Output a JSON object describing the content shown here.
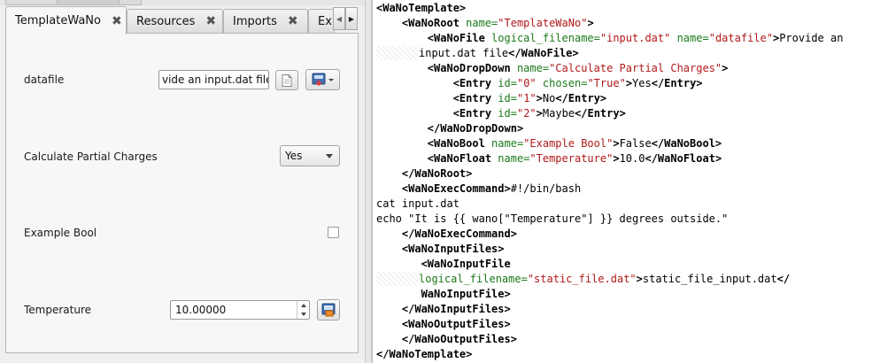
{
  "tabs": [
    {
      "label": "TemplateWaNo",
      "close": "✖"
    },
    {
      "label": "Resources",
      "close": "✖"
    },
    {
      "label": "Imports",
      "close": "✖"
    },
    {
      "label": "Ex"
    }
  ],
  "form": {
    "datafile": {
      "label": "datafile",
      "value": "vide an input.dat file"
    },
    "partial_charges": {
      "label": "Calculate Partial Charges",
      "selected": "Yes"
    },
    "example_bool": {
      "label": "Example Bool",
      "checked": false
    },
    "temperature": {
      "label": "Temperature",
      "value": "10.00000"
    }
  },
  "code": [
    [
      {
        "c": "t",
        "s": "<WaNoTemplate>"
      }
    ],
    [
      {
        "c": "t",
        "s": "    <WaNoRoot "
      },
      {
        "c": "a",
        "s": "name="
      },
      {
        "c": "v",
        "s": "\"TemplateWaNo\""
      },
      {
        "c": "t",
        "s": ">"
      }
    ],
    [
      {
        "c": "t",
        "s": "        <WaNoFile "
      },
      {
        "c": "a",
        "s": "logical_filename="
      },
      {
        "c": "v",
        "s": "\"input.dat\""
      },
      {
        "c": "a",
        "s": " name="
      },
      {
        "c": "v",
        "s": "\"datafile\""
      },
      {
        "c": "t",
        "s": ">"
      },
      {
        "c": "tx",
        "s": "Provide an"
      }
    ],
    [
      {
        "c": "h"
      },
      {
        "c": "tx",
        "s": "input.dat file"
      },
      {
        "c": "t",
        "s": "</WaNoFile>"
      }
    ],
    [
      {
        "c": "t",
        "s": "        <WaNoDropDown "
      },
      {
        "c": "a",
        "s": "name="
      },
      {
        "c": "v",
        "s": "\"Calculate Partial Charges\""
      },
      {
        "c": "t",
        "s": ">"
      }
    ],
    [
      {
        "c": "t",
        "s": "            <Entry "
      },
      {
        "c": "a",
        "s": "id="
      },
      {
        "c": "v",
        "s": "\"0\""
      },
      {
        "c": "a",
        "s": " chosen="
      },
      {
        "c": "v",
        "s": "\"True\""
      },
      {
        "c": "t",
        "s": ">"
      },
      {
        "c": "tx",
        "s": "Yes"
      },
      {
        "c": "t",
        "s": "</Entry>"
      }
    ],
    [
      {
        "c": "t",
        "s": "            <Entry "
      },
      {
        "c": "a",
        "s": "id="
      },
      {
        "c": "v",
        "s": "\"1\""
      },
      {
        "c": "t",
        "s": ">"
      },
      {
        "c": "tx",
        "s": "No"
      },
      {
        "c": "t",
        "s": "</Entry>"
      }
    ],
    [
      {
        "c": "t",
        "s": "            <Entry "
      },
      {
        "c": "a",
        "s": "id="
      },
      {
        "c": "v",
        "s": "\"2\""
      },
      {
        "c": "t",
        "s": ">"
      },
      {
        "c": "tx",
        "s": "Maybe"
      },
      {
        "c": "t",
        "s": "</Entry>"
      }
    ],
    [
      {
        "c": "t",
        "s": "        </WaNoDropDown>"
      }
    ],
    [
      {
        "c": "t",
        "s": "        <WaNoBool "
      },
      {
        "c": "a",
        "s": "name="
      },
      {
        "c": "v",
        "s": "\"Example Bool\""
      },
      {
        "c": "t",
        "s": ">"
      },
      {
        "c": "tx",
        "s": "False"
      },
      {
        "c": "t",
        "s": "</WaNoBool>"
      }
    ],
    [
      {
        "c": "t",
        "s": "        <WaNoFloat "
      },
      {
        "c": "a",
        "s": "name="
      },
      {
        "c": "v",
        "s": "\"Temperature\""
      },
      {
        "c": "t",
        "s": ">"
      },
      {
        "c": "tx",
        "s": "10.0"
      },
      {
        "c": "t",
        "s": "</WaNoFloat>"
      }
    ],
    [
      {
        "c": "t",
        "s": "    </WaNoRoot>"
      }
    ],
    [
      {
        "c": "t",
        "s": "    <WaNoExecCommand>"
      },
      {
        "c": "tx",
        "s": "#!/bin/bash"
      }
    ],
    [
      {
        "c": "tx",
        "s": "cat input.dat"
      }
    ],
    [
      {
        "c": "tx",
        "s": "echo \"It is {{ wano[\"Temperature\"] }} degrees outside.\""
      }
    ],
    [
      {
        "c": "t",
        "s": "    </WaNoExecCommand>"
      }
    ],
    [
      {
        "c": "t",
        "s": "    <WaNoInputFiles>"
      }
    ],
    [
      {
        "c": "t",
        "s": "       <WaNoInputFile"
      }
    ],
    [
      {
        "c": "h"
      },
      {
        "c": "a",
        "s": "logical_filename="
      },
      {
        "c": "v",
        "s": "\"static_file.dat\""
      },
      {
        "c": "t",
        "s": ">"
      },
      {
        "c": "tx",
        "s": "static_file_input.dat"
      },
      {
        "c": "t",
        "s": "</"
      }
    ],
    [
      {
        "c": "t",
        "s": "       WaNoInputFile>"
      }
    ],
    [
      {
        "c": "t",
        "s": "    </WaNoInputFiles>"
      }
    ],
    [
      {
        "c": "t",
        "s": "    <WaNoOutputFiles>"
      }
    ],
    [
      {
        "c": "t",
        "s": "    </WaNoOutputFiles>"
      }
    ],
    [
      {
        "c": "t",
        "s": "</WaNoTemplate>"
      }
    ]
  ]
}
